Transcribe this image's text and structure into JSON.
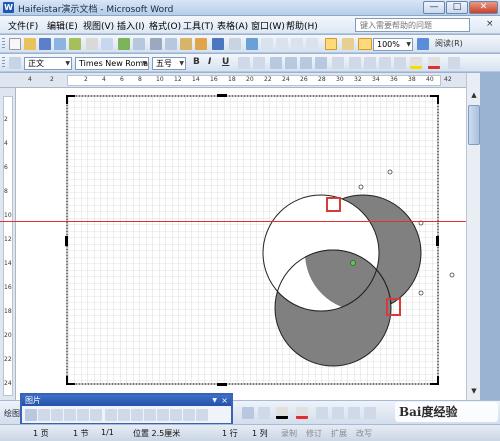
{
  "window": {
    "title": "Haifeistar演示文档 - Microsoft Word",
    "minimize": "—",
    "maximize": "□",
    "close": "✕"
  },
  "menubar": {
    "items": [
      "文件(F)",
      "编辑(E)",
      "视图(V)",
      "插入(I)",
      "格式(O)",
      "工具(T)",
      "表格(A)",
      "窗口(W)",
      "帮助(H)"
    ],
    "help_placeholder": "键入需要帮助的问题",
    "close_doc": "×"
  },
  "toolbar_standard": {
    "zoom": "100%",
    "reading": "阅读(R)"
  },
  "toolbar_format": {
    "style": "正文",
    "font": "Times New Roman",
    "size": "五号",
    "bold": "B",
    "italic": "I",
    "underline": "U"
  },
  "ruler": {
    "h_ticks": [
      "4",
      "2",
      "2",
      "4",
      "6",
      "8",
      "10",
      "12",
      "14",
      "16",
      "18",
      "20",
      "22",
      "24",
      "26",
      "28",
      "30",
      "32",
      "34",
      "36",
      "38",
      "40",
      "42"
    ],
    "v_ticks": [
      "2",
      "4",
      "6",
      "8",
      "10",
      "12",
      "14",
      "16",
      "18",
      "20",
      "22",
      "24"
    ]
  },
  "picture_toolbar": {
    "title": "图片"
  },
  "bottom_toolbar": {
    "draw_label": "绘图"
  },
  "status": {
    "page": "1 页",
    "section": "1 节",
    "pages": "1/1",
    "position": "位置 2.5厘米",
    "line": "1 行",
    "column": "1 列",
    "rec": "录制",
    "trk": "修订",
    "ext": "扩展",
    "ovr": "改写"
  },
  "watermark": "Bai度经验",
  "colors": {
    "accent_red": "#e03030",
    "shape_fill": "#808080",
    "grid": "#c8c8c8",
    "selection_box": "#d83a3a"
  }
}
